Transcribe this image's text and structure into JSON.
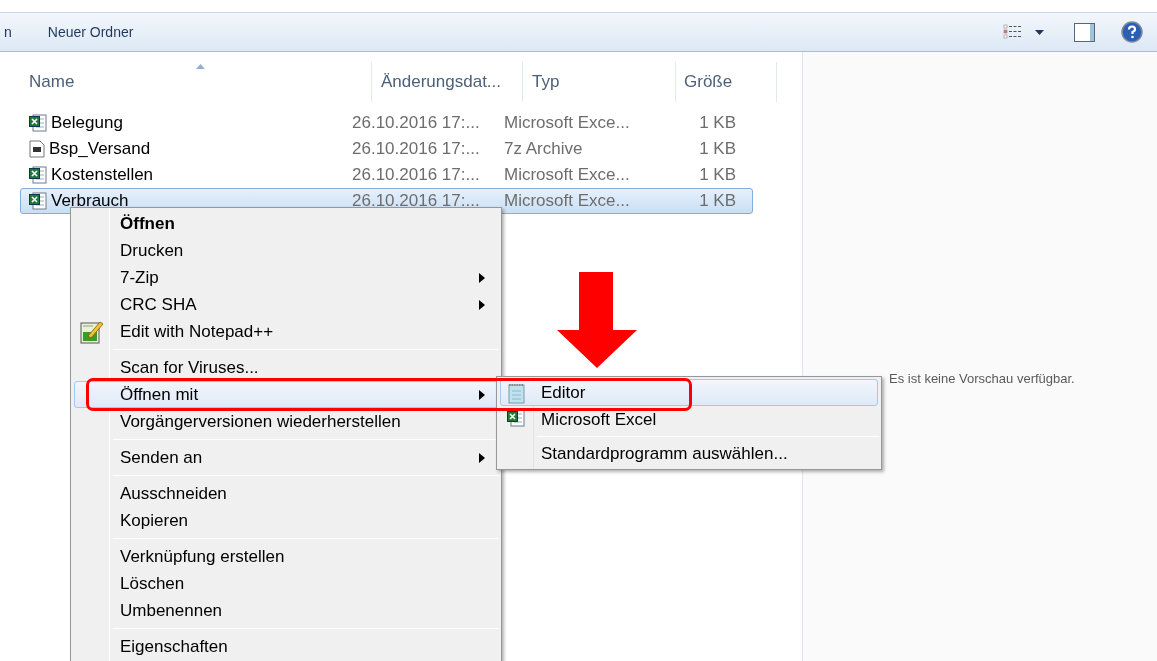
{
  "toolbar": {
    "cut_label": "n",
    "new_folder": "Neuer Ordner"
  },
  "columns": [
    {
      "label": "Name",
      "sorted": true
    },
    {
      "label": "Änderungsdat...",
      "sorted": false
    },
    {
      "label": "Typ",
      "sorted": false
    },
    {
      "label": "Größe",
      "sorted": false
    }
  ],
  "files": [
    {
      "name": "Belegung",
      "date": "26.10.2016 17:...",
      "type": "Microsoft Exce...",
      "size": "1 KB",
      "kind": "excel",
      "selected": false
    },
    {
      "name": "Bsp_Versand",
      "date": "26.10.2016 17:...",
      "type": "7z Archive",
      "size": "1 KB",
      "kind": "archive",
      "selected": false
    },
    {
      "name": "Kostenstellen",
      "date": "26.10.2016 17:...",
      "type": "Microsoft Exce...",
      "size": "1 KB",
      "kind": "excel",
      "selected": false
    },
    {
      "name": "Verbrauch",
      "date": "26.10.2016 17:...",
      "type": "Microsoft Exce...",
      "size": "1 KB",
      "kind": "excel",
      "selected": true
    }
  ],
  "context_menu": [
    {
      "kind": "item",
      "label": "Öffnen",
      "bold": true,
      "submenu": false,
      "selected": false
    },
    {
      "kind": "item",
      "label": "Drucken",
      "bold": false,
      "submenu": false,
      "selected": false
    },
    {
      "kind": "item",
      "label": "7-Zip",
      "bold": false,
      "submenu": true,
      "selected": false
    },
    {
      "kind": "item",
      "label": "CRC SHA",
      "bold": false,
      "submenu": true,
      "selected": false
    },
    {
      "kind": "notepad_item",
      "label": "Edit with Notepad++",
      "bold": false,
      "submenu": false,
      "selected": false
    },
    {
      "kind": "separator"
    },
    {
      "kind": "item",
      "label": "Scan for Viruses...",
      "bold": false,
      "submenu": false,
      "selected": false
    },
    {
      "kind": "item",
      "label": "Öffnen mit",
      "bold": false,
      "submenu": true,
      "selected": true
    },
    {
      "kind": "item",
      "label": "Vorgängerversionen wiederherstellen",
      "bold": false,
      "submenu": false,
      "selected": false
    },
    {
      "kind": "separator"
    },
    {
      "kind": "item",
      "label": "Senden an",
      "bold": false,
      "submenu": true,
      "selected": false
    },
    {
      "kind": "separator"
    },
    {
      "kind": "item",
      "label": "Ausschneiden",
      "bold": false,
      "submenu": false,
      "selected": false
    },
    {
      "kind": "item",
      "label": "Kopieren",
      "bold": false,
      "submenu": false,
      "selected": false
    },
    {
      "kind": "separator"
    },
    {
      "kind": "item",
      "label": "Verknüpfung erstellen",
      "bold": false,
      "submenu": false,
      "selected": false
    },
    {
      "kind": "item",
      "label": "Löschen",
      "bold": false,
      "submenu": false,
      "selected": false
    },
    {
      "kind": "item",
      "label": "Umbenennen",
      "bold": false,
      "submenu": false,
      "selected": false
    },
    {
      "kind": "separator"
    },
    {
      "kind": "item",
      "label": "Eigenschaften",
      "bold": false,
      "submenu": false,
      "selected": false
    }
  ],
  "open_with_menu": [
    {
      "kind": "editor_item",
      "label": "Editor",
      "selected": true
    },
    {
      "kind": "excel_item",
      "label": "Microsoft Excel",
      "selected": false
    },
    {
      "kind": "separator"
    },
    {
      "kind": "item",
      "label": "Standardprogramm auswählen...",
      "selected": false
    }
  ],
  "preview": {
    "message": "Es ist keine Vorschau verfügbar."
  }
}
